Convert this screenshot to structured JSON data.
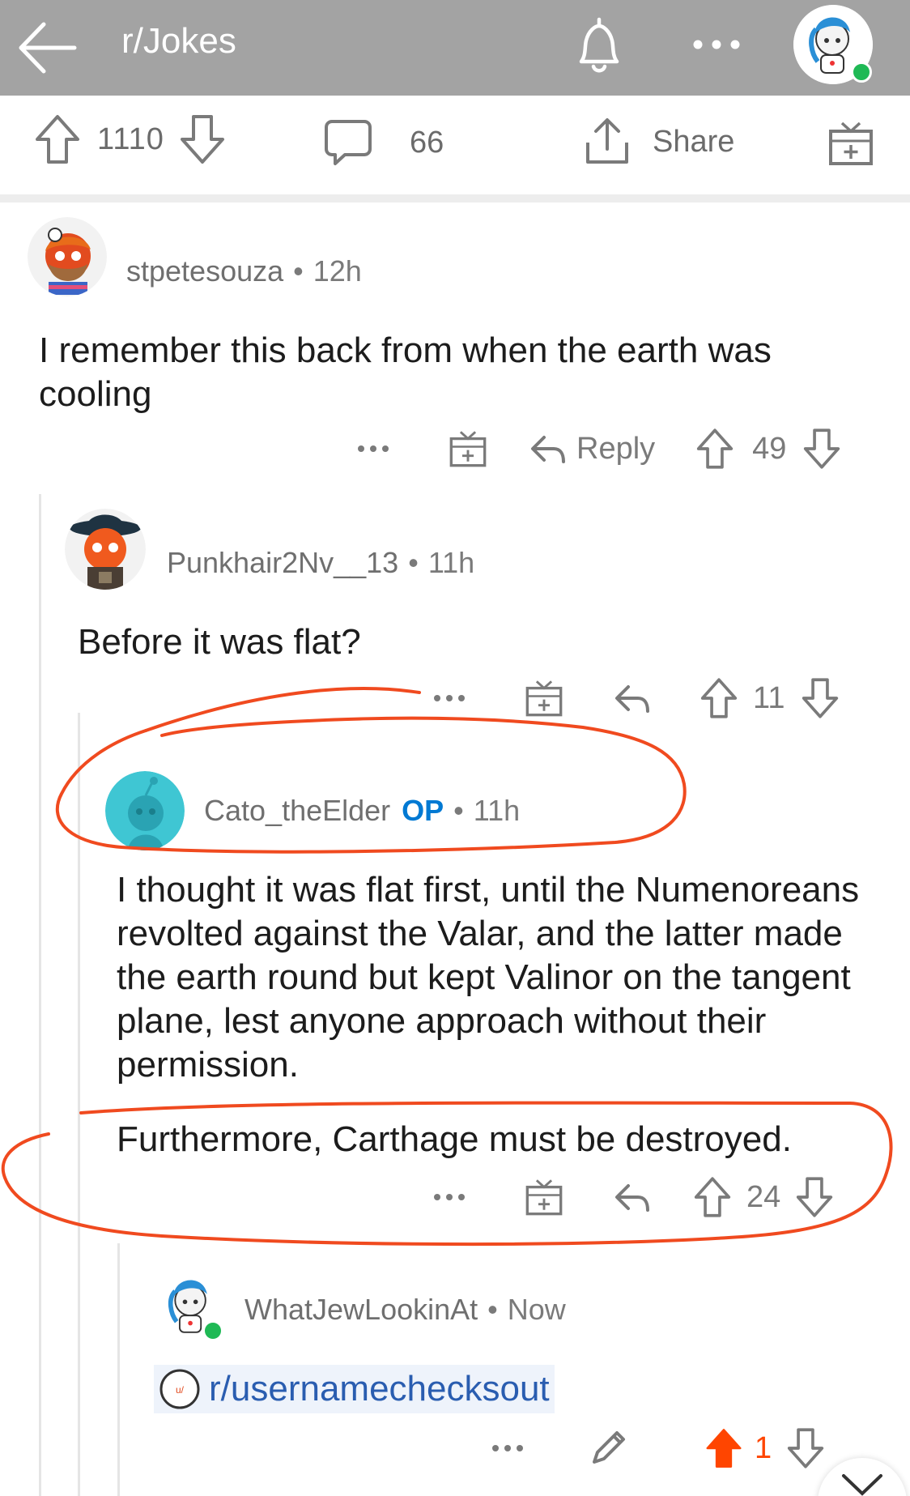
{
  "header": {
    "subreddit": "r/Jokes",
    "icons": [
      "back-arrow-icon",
      "bell-icon",
      "more-icon",
      "avatar"
    ]
  },
  "post_actions": {
    "upvotes": "1110",
    "comments": "66",
    "share_label": "Share"
  },
  "comments": [
    {
      "username": "stpetesouza",
      "time": "12h",
      "text": "I remember this back from when the earth was cooling",
      "score": "49",
      "reply_label": "Reply"
    },
    {
      "username": "Punkhair2Nv__13",
      "time": "11h",
      "text": "Before it was flat?",
      "score": "11"
    },
    {
      "username": "Cato_theElder",
      "op_badge": "OP",
      "time": "11h",
      "text": "I thought it was flat first, until the Numenoreans revolted against the Valar, and the latter made the earth round but kept Valinor on the tangent plane, lest anyone approach without their permission.",
      "text2": "Furthermore, Carthage must be destroyed.",
      "score": "24"
    },
    {
      "username": "WhatJewLookinAt",
      "time": "Now",
      "link": "r/usernamechecksout",
      "score": "1"
    }
  ],
  "separator": "•",
  "colors": {
    "topbar": "#a3a3a3",
    "upvote_active": "#ff4500",
    "link": "#2a5db0",
    "op": "#0079d3",
    "annotation": "#f04a1f"
  }
}
